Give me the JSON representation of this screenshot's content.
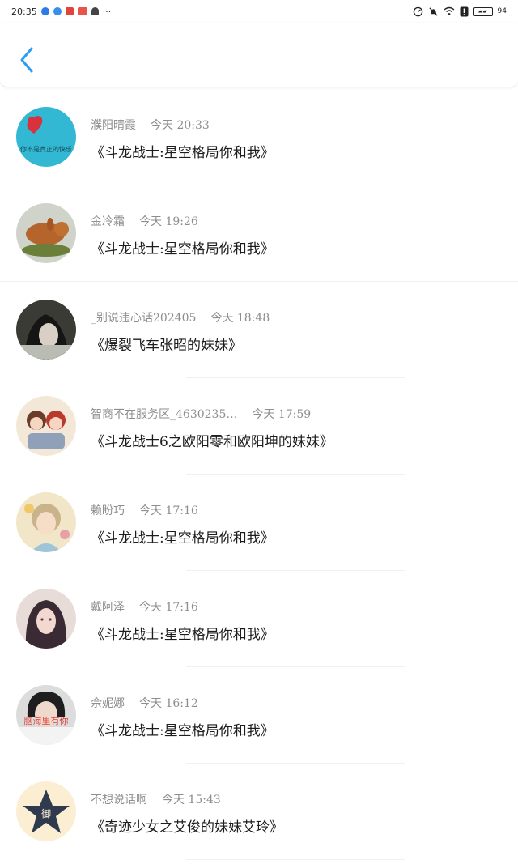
{
  "status_bar": {
    "time": "20:35",
    "battery": "94"
  },
  "header": {
    "back_icon": "chevron-left-icon"
  },
  "colors": {
    "accent": "#2a9df4"
  },
  "items": [
    {
      "name": "濮阳晴霞",
      "time": "今天 20:33",
      "message": "《斗龙战士:星空格局你和我》",
      "avatar_text": "你不是真正的快乐"
    },
    {
      "name": "金冷霜",
      "time": "今天 19:26",
      "message": "《斗龙战士:星空格局你和我》",
      "avatar_text": ""
    },
    {
      "name": "_别说违心话202405",
      "time": "今天 18:48",
      "message": "《爆裂飞车张昭的妹妹》",
      "avatar_text": ""
    },
    {
      "name": "智商不在服务区_4630235…",
      "time": "今天 17:59",
      "message": "《斗龙战士6之欧阳零和欧阳坤的妹妹》",
      "avatar_text": ""
    },
    {
      "name": "赖盼巧",
      "time": "今天 17:16",
      "message": "《斗龙战士:星空格局你和我》",
      "avatar_text": ""
    },
    {
      "name": "戴阿泽",
      "time": "今天 17:16",
      "message": "《斗龙战士:星空格局你和我》",
      "avatar_text": ""
    },
    {
      "name": "佘妮娜",
      "time": "今天 16:12",
      "message": "《斗龙战士:星空格局你和我》",
      "avatar_text": "脑海里有你"
    },
    {
      "name": "不想说话啊",
      "time": "今天 15:43",
      "message": "《奇迹少女之艾俊的妹妹艾玲》",
      "avatar_text": "御"
    }
  ]
}
